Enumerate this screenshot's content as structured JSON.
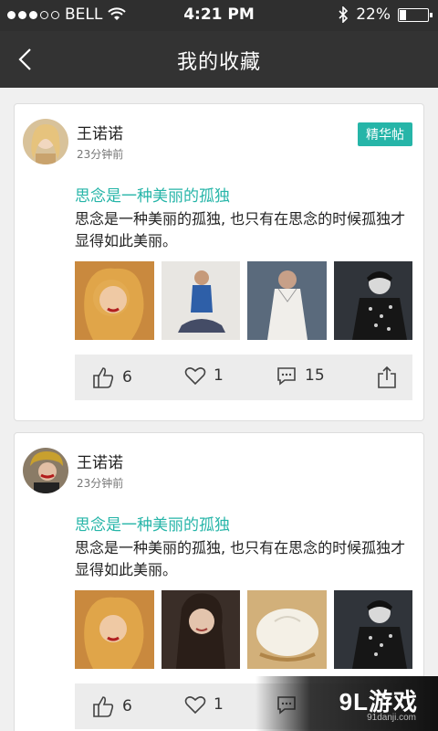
{
  "status": {
    "carrier": "BELL",
    "time": "4:21 PM",
    "battery": "22%",
    "battery_level": 0.22
  },
  "nav": {
    "title": "我的收藏",
    "back_icon": "chevron-left-icon"
  },
  "posts": [
    {
      "user": "王诺诺",
      "time": "23分钟前",
      "badge": "精华帖",
      "title": "思念是一种美丽的孤独",
      "body": "思念是一种美丽的孤独, 也只有在思念的时候孤独才显得如此美丽。",
      "likes": "6",
      "favs": "1",
      "comments": "15"
    },
    {
      "user": "王诺诺",
      "time": "23分钟前",
      "title": "思念是一种美丽的孤独",
      "body": "思念是一种美丽的孤独, 也只有在思念的时候孤独才显得如此美丽。",
      "likes": "6",
      "favs": "1"
    }
  ],
  "watermark": {
    "brand": "9L游戏",
    "site": "91danji.com"
  },
  "colors": {
    "accent": "#26b5a8",
    "nav_bg": "#333333"
  }
}
